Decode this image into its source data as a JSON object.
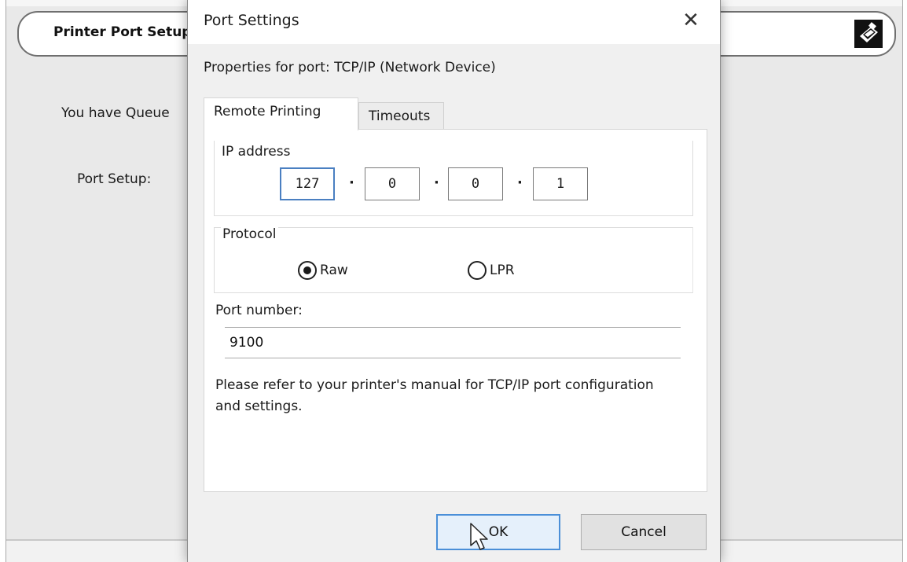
{
  "background_window": {
    "title": "Printer Port Setup",
    "queue_label": "You have Queue",
    "port_setup_label": "Port Setup:",
    "icon": "printer-icon"
  },
  "dialog": {
    "title": "Port Settings",
    "close_glyph": "✕",
    "subtitle": "Properties for port: TCP/IP (Network Device)",
    "tabs": [
      {
        "label": "Remote Printing",
        "active": true
      },
      {
        "label": "Timeouts",
        "active": false
      }
    ],
    "ip_group": {
      "label": "IP address",
      "octets": [
        "127",
        "0",
        "0",
        "1"
      ],
      "separator": "·"
    },
    "protocol_group": {
      "label": "Protocol",
      "options": [
        {
          "label": "Raw",
          "checked": true
        },
        {
          "label": "LPR",
          "checked": false
        }
      ]
    },
    "port": {
      "label": "Port number:",
      "value": "9100"
    },
    "note": "Please refer to your printer's manual for TCP/IP port configuration and settings.",
    "buttons": {
      "ok": "OK",
      "cancel": "Cancel"
    }
  },
  "colors": {
    "focus_blue": "#4a8fd8",
    "dialog_bg": "#f0f0f0",
    "panel_bg": "#ffffff"
  }
}
